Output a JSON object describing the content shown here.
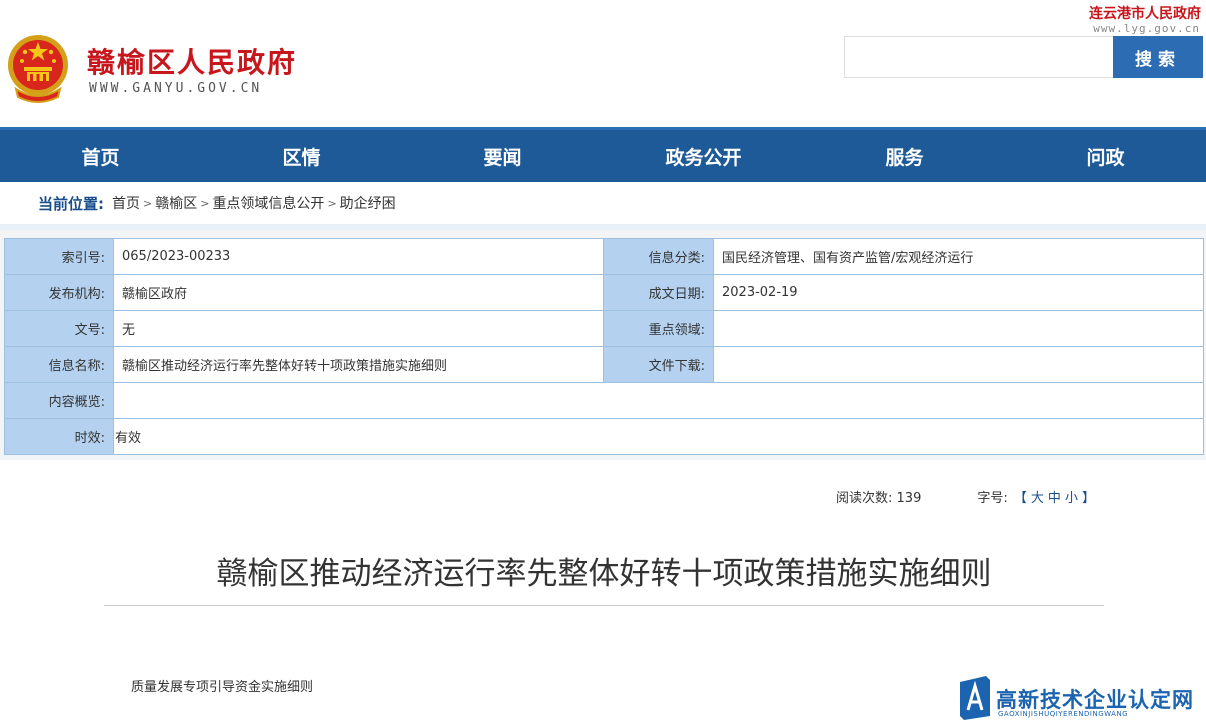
{
  "header": {
    "site_title": "赣榆区人民政府",
    "site_domain": "WWW.GANYU.GOV.CN",
    "city_name": "连云港市人民政府",
    "city_domain": "www.lyg.gov.cn",
    "search_placeholder": "",
    "search_button": "搜索"
  },
  "nav": [
    "首页",
    "区情",
    "要闻",
    "政务公开",
    "服务",
    "问政"
  ],
  "breadcrumb": {
    "label": "当前位置:",
    "items": [
      "首页",
      "赣榆区",
      "重点领域信息公开",
      "助企纾困"
    ],
    "separators": [
      ">",
      ">",
      ">"
    ]
  },
  "info": {
    "index_label": "索引号:",
    "index_value": "065/2023-00233",
    "category_label": "信息分类:",
    "category_value": "国民经济管理、国有资产监管/宏观经济运行",
    "publisher_label": "发布机构:",
    "publisher_value": "赣榆区政府",
    "date_label": "成文日期:",
    "date_value": "2023-02-19",
    "doc_no_label": "文号:",
    "doc_no_value": "无",
    "focus_label": "重点领域:",
    "focus_value": "",
    "name_label": "信息名称:",
    "name_value": "赣榆区推动经济运行率先整体好转十项政策措施实施细则",
    "download_label": "文件下载:",
    "download_value": "",
    "summary_label": "内容概览:",
    "summary_value": "",
    "validity_label": "时效:",
    "validity_value": "有效"
  },
  "meta": {
    "reads_label": "阅读次数:",
    "reads_value": "139",
    "font_label": "字号:",
    "bracket_open": "【",
    "large": "大",
    "medium": "中",
    "small": "小",
    "bracket_close": "】"
  },
  "article": {
    "title": "赣榆区推动经济运行率先整体好转十项政策措施实施细则",
    "first_line": "质量发展专项引导资金实施细则"
  },
  "watermark": {
    "text": "高新技术企业认定网",
    "sub": "GAOXINJISHUQIYERENDINGWANG"
  },
  "colors": {
    "brand_red": "#c8161d",
    "nav_blue": "#1e5a97",
    "label_blue": "#b4d2ef",
    "search_blue": "#2b6cb3"
  }
}
